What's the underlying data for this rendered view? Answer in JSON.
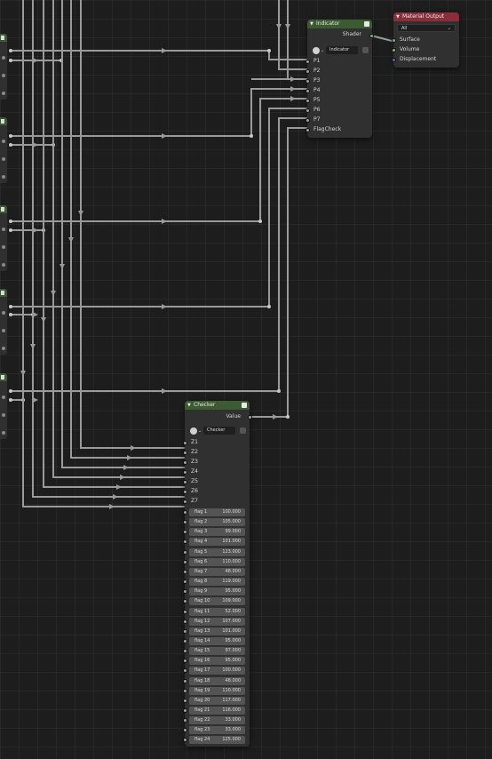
{
  "nodes": {
    "indicator": {
      "title": "Indicator",
      "output_label": "Shader",
      "group_name": "Indicator",
      "inputs": [
        "P1",
        "P2",
        "P3",
        "P4",
        "P5",
        "P6",
        "P7",
        "FlagCheck"
      ],
      "header_color": "#3c5b32"
    },
    "material_output": {
      "title": "Material Output",
      "target": "All",
      "inputs": [
        "Surface",
        "Volume",
        "Displacement"
      ],
      "header_color": "#8a2e3b"
    },
    "checker": {
      "title": "Checker",
      "output_label": "Value",
      "group_name": "Checker",
      "inputs": [
        "Z1",
        "Z2",
        "Z3",
        "Z4",
        "Z5",
        "Z6",
        "Z7"
      ],
      "header_color": "#3c5b32",
      "flags": [
        {
          "label": "flag 1",
          "value": "100.000"
        },
        {
          "label": "flag 2",
          "value": "105.000"
        },
        {
          "label": "flag 3",
          "value": "99.000"
        },
        {
          "label": "flag 4",
          "value": "101.000"
        },
        {
          "label": "flag 5",
          "value": "123.000"
        },
        {
          "label": "flag 6",
          "value": "110.000"
        },
        {
          "label": "flag 7",
          "value": "48.000"
        },
        {
          "label": "flag 8",
          "value": "119.000"
        },
        {
          "label": "flag 9",
          "value": "95.000"
        },
        {
          "label": "flag 10",
          "value": "109.000"
        },
        {
          "label": "flag 11",
          "value": "52.000"
        },
        {
          "label": "flag 12",
          "value": "107.000"
        },
        {
          "label": "flag 13",
          "value": "101.000"
        },
        {
          "label": "flag 14",
          "value": "95.000"
        },
        {
          "label": "flag 15",
          "value": "97.000"
        },
        {
          "label": "flag 16",
          "value": "95.000"
        },
        {
          "label": "flag 17",
          "value": "100.000"
        },
        {
          "label": "flag 18",
          "value": "48.000"
        },
        {
          "label": "flag 19",
          "value": "110.000"
        },
        {
          "label": "flag 20",
          "value": "117.000"
        },
        {
          "label": "flag 21",
          "value": "116.000"
        },
        {
          "label": "flag 22",
          "value": "33.000"
        },
        {
          "label": "flag 23",
          "value": "33.000"
        },
        {
          "label": "flag 24",
          "value": "125.000"
        }
      ]
    }
  },
  "colors": {
    "background": "#1d1d1d",
    "node_body": "#303030",
    "group_header": "#3c5b32",
    "output_header": "#8a2e3b",
    "wire": "#9a9a9a",
    "shader_socket": "#63c763",
    "vector_socket": "#6363c7",
    "float_socket": "#a1a1a1"
  },
  "icons": {
    "node_group_header": "node-tree-icon",
    "datablock_selector": "node-group-datablock-icon",
    "fake_user": "fake-user-shield-icon",
    "collapse": "chevron-down-icon"
  }
}
